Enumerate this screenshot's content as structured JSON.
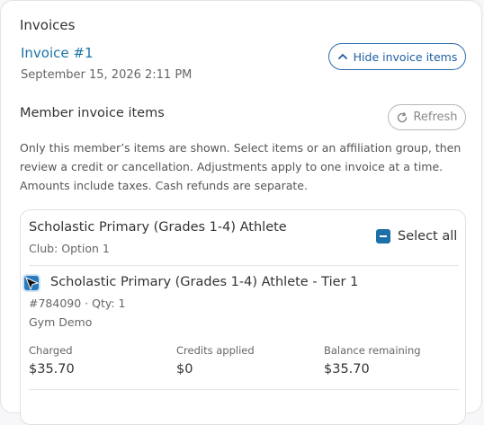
{
  "invoices": {
    "section_title": "Invoices",
    "invoice_link": "Invoice #1",
    "invoice_date": "September 15, 2026 2:11 PM",
    "hide_button": "Hide invoice items"
  },
  "member_items": {
    "title": "Member invoice items",
    "refresh_button": "Refresh",
    "info_text": "Only this member’s items are shown. Select items or an affiliation group, then review a credit or cancellation. Adjustments apply to one invoice at a time. Amounts include taxes. Cash refunds are separate."
  },
  "group": {
    "title": "Scholastic Primary (Grades 1-4) Athlete",
    "subtitle": "Club: Option 1",
    "select_all": "Select all"
  },
  "item": {
    "title": "Scholastic Primary (Grades 1-4) Athlete - Tier 1",
    "sku": "#784090 · Qty: 1",
    "location": "Gym Demo",
    "charged_label": "Charged",
    "charged_value": "$35.70",
    "credits_label": "Credits applied",
    "credits_value": "$0",
    "balance_label": "Balance remaining",
    "balance_value": "$35.70"
  },
  "colors": {
    "accent": "#1d6fa8",
    "link": "#1a73a8"
  }
}
